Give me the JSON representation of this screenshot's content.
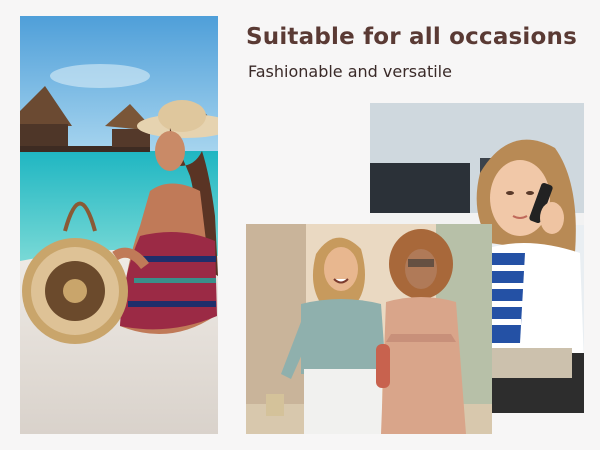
{
  "headline": "Suitable for all occasions",
  "subline": "Fashionable and versatile",
  "photos": [
    {
      "name": "beach-photo",
      "icon": "beach-woman-with-straw-bag"
    },
    {
      "name": "phone-call-photo",
      "icon": "woman-on-phone-cafe"
    },
    {
      "name": "friends-walking-photo",
      "icon": "two-women-laughing-walking"
    }
  ],
  "colors": {
    "headline": "#5a3a34",
    "subline": "#3a2a28",
    "background": "#f7f6f6"
  }
}
